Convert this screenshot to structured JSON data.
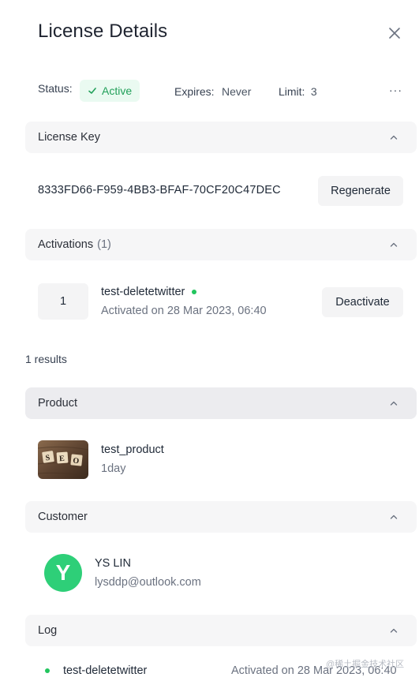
{
  "header": {
    "title": "License Details"
  },
  "summary": {
    "status_label": "Status:",
    "status_value": "Active",
    "expires_label": "Expires:",
    "expires_value": "Never",
    "limit_label": "Limit:",
    "limit_value": "3",
    "more_label": "···"
  },
  "license_key": {
    "header": "License Key",
    "key": "8333FD66-F959-4BB3-BFAF-70CF20C47DEC",
    "regenerate_label": "Regenerate"
  },
  "activations": {
    "header": "Activations",
    "count": "(1)",
    "items": [
      {
        "index": "1",
        "name": "test-deletetwitter",
        "activated": "Activated on 28 Mar 2023, 06:40",
        "action": "Deactivate"
      }
    ],
    "results": "1 results"
  },
  "product": {
    "header": "Product",
    "name": "test_product",
    "duration": "1day",
    "image_text": "SEO"
  },
  "customer": {
    "header": "Customer",
    "initial": "Y",
    "name": "YS LIN",
    "email": "lysddp@outlook.com"
  },
  "log": {
    "header": "Log",
    "entries": [
      {
        "name": "test-deletetwitter",
        "activated": "Activated on 28 Mar 2023, 06:40"
      }
    ]
  },
  "watermark": "@稀土掘金技术社区",
  "colors": {
    "accent_green": "#22c55e",
    "avatar_green": "#2ecf78",
    "badge_bg": "#eafaf1"
  }
}
